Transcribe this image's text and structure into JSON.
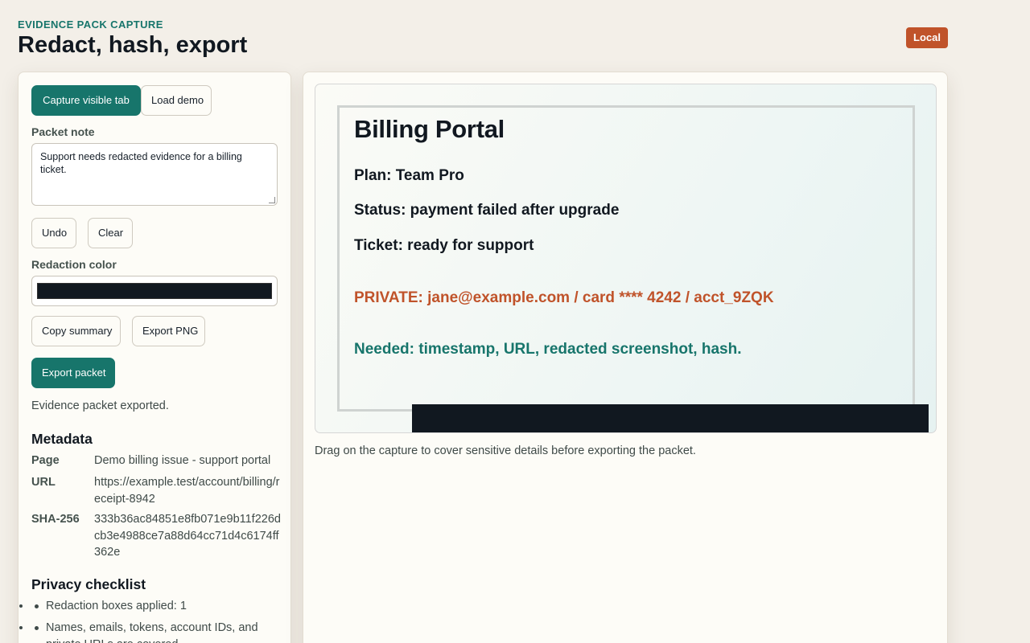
{
  "header": {
    "eyebrow": "EVIDENCE PACK CAPTURE",
    "title": "Redact, hash, export",
    "badge": "Local"
  },
  "controls": {
    "capture_label": "Capture visible tab",
    "load_demo_label": "Load demo",
    "packet_note_label": "Packet note",
    "packet_note_value": "Support needs redacted evidence for a billing ticket.",
    "undo_label": "Undo",
    "clear_label": "Clear",
    "redaction_color_label": "Redaction color",
    "redaction_color_value": "#111820",
    "copy_summary_label": "Copy summary",
    "export_png_label": "Export PNG",
    "export_packet_label": "Export packet",
    "status": "Evidence packet exported."
  },
  "metadata": {
    "heading": "Metadata",
    "page_key": "Page",
    "page_value": "Demo billing issue - support portal",
    "url_key": "URL",
    "url_value": "https://example.test/account/billing/receipt-8942",
    "hash_key": "SHA-256",
    "hash_value": "333b36ac84851e8fb071e9b11f226dcb3e4988ce7a88d64cc71d4c6174ff362e"
  },
  "checklist": {
    "heading": "Privacy checklist",
    "items": [
      "Redaction boxes applied: 1",
      "Names, emails, tokens, account IDs, and private URLs are covered."
    ]
  },
  "capture": {
    "title": "Billing Portal",
    "plan": "Plan: Team Pro",
    "status": "Status: payment failed after upgrade",
    "ticket": "Ticket: ready for support",
    "private": "PRIVATE: jane@example.com / card **** 4242 / acct_9ZQK",
    "needed": "Needed: timestamp, URL, redacted screenshot, hash.",
    "hint": "Drag on the capture to cover sensitive details before exporting the packet."
  },
  "colors": {
    "accent": "#17756b",
    "badge": "#c0532a",
    "redaction": "#111820",
    "background": "#f3efe8"
  }
}
